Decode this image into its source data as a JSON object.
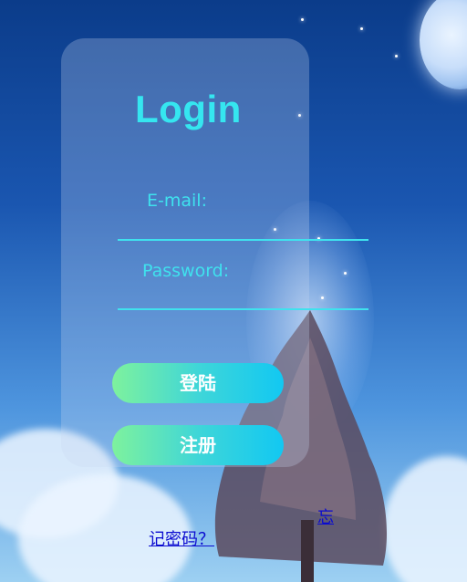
{
  "login": {
    "title": "Login",
    "email_label": "E-mail:",
    "email_value": "",
    "password_label": "Password:",
    "password_value": "",
    "login_button": "登陆",
    "register_button": "注册",
    "forgot_link": "记密码？",
    "right_link": "忘"
  },
  "colors": {
    "accent": "#35e6f0",
    "button_start": "#7ef29d",
    "button_end": "#12c8f2",
    "link": "#0a0ad0"
  }
}
